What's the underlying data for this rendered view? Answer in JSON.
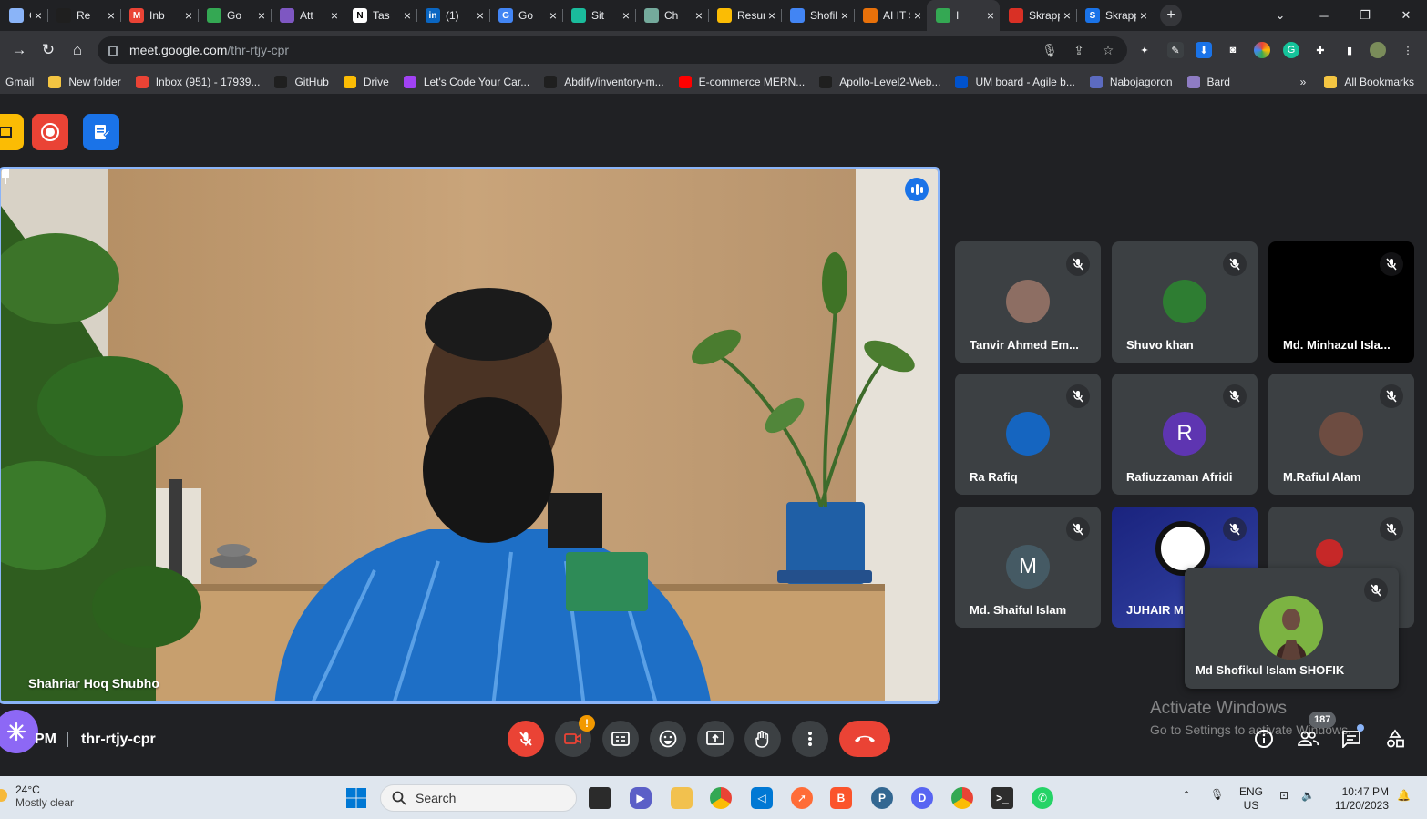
{
  "browser": {
    "tabs": [
      {
        "title": "Cre",
        "color": "#8ab4f8",
        "glyph": ""
      },
      {
        "title": "Re",
        "color": "#1f1f1f",
        "glyph": ""
      },
      {
        "title": "Inb",
        "color": "#ea4335",
        "glyph": "M"
      },
      {
        "title": "Go",
        "color": "#34a853",
        "glyph": ""
      },
      {
        "title": "Att",
        "color": "#7e57c2",
        "glyph": ""
      },
      {
        "title": "Tas",
        "color": "#ffffff",
        "glyph": "N"
      },
      {
        "title": "(1)",
        "color": "#0a66c2",
        "glyph": "in"
      },
      {
        "title": "Go",
        "color": "#4285f4",
        "glyph": "G"
      },
      {
        "title": "Sit",
        "color": "#1abc9c",
        "glyph": ""
      },
      {
        "title": "Ch",
        "color": "#74aa9c",
        "glyph": ""
      },
      {
        "title": "Resume",
        "color": "#fbbc04",
        "glyph": ""
      },
      {
        "title": "Shofiku",
        "color": "#4285f4",
        "glyph": ""
      },
      {
        "title": "AI IT Sh",
        "color": "#e8710a",
        "glyph": ""
      },
      {
        "title": "I",
        "color": "#34a853",
        "glyph": ""
      },
      {
        "title": "Skrappa",
        "color": "#d93025",
        "glyph": ""
      },
      {
        "title": "Skrapp",
        "color": "#1a73e8",
        "glyph": "S"
      }
    ],
    "new_tab_label": "+",
    "url_host": "meet.google.com",
    "url_path": "/thr-rtjy-cpr",
    "bookmarks": [
      {
        "label": "Gmail",
        "color": ""
      },
      {
        "label": "New folder",
        "color": "#f4c542"
      },
      {
        "label": "Inbox (951) - 17939...",
        "color": "#ea4335"
      },
      {
        "label": "GitHub",
        "color": "#1f1f1f"
      },
      {
        "label": "Drive",
        "color": "#fbbc04"
      },
      {
        "label": "Let's Code Your Car...",
        "color": "#a142f4"
      },
      {
        "label": "Abdify/inventory-m...",
        "color": "#1f1f1f"
      },
      {
        "label": "E-commerce MERN...",
        "color": "#ff0000"
      },
      {
        "label": "Apollo-Level2-Web...",
        "color": "#1f1f1f"
      },
      {
        "label": "UM board - Agile b...",
        "color": "#0052cc"
      },
      {
        "label": "Nabojagoron",
        "color": "#5c6bc0"
      },
      {
        "label": "Bard",
        "color": "#8e7cc3"
      }
    ],
    "bookmarks_overflow": "»",
    "all_bookmarks": "All Bookmarks"
  },
  "meet": {
    "main_speaker_name": "Shahriar Hoq Shubho",
    "participants": [
      {
        "name": "Tanvir Ahmed Em...",
        "initial": "",
        "avatar_color": "#8d6e63"
      },
      {
        "name": "Shuvo khan",
        "initial": "",
        "avatar_color": "#2e7d32"
      },
      {
        "name": "Md. Minhazul Isla...",
        "initial": "",
        "avatar_color": "#000000"
      },
      {
        "name": "Ra Rafiq",
        "initial": "",
        "avatar_color": "#1565c0"
      },
      {
        "name": "Rafiuzzaman Afridi",
        "initial": "R",
        "avatar_color": "#5e35b1"
      },
      {
        "name": "M.Rafiul Alam",
        "initial": "",
        "avatar_color": "#6d4c41"
      },
      {
        "name": "Md. Shaiful Islam",
        "initial": "M",
        "avatar_color": "#455a64"
      },
      {
        "name": "JUHAIR M",
        "initial": "",
        "avatar_color": "#1a237e"
      },
      {
        "name": "",
        "initial": "",
        "avatar_color": "#c62828"
      }
    ],
    "self_name": "Md Shofikul Islam SHOFIK",
    "meeting_time_suffix": "PM",
    "meeting_code": "thr-rtjy-cpr",
    "camera_alert": "!",
    "people_count": "187",
    "colors": {
      "accent": "#8ab4f8",
      "end_call": "#ea4335",
      "tile_bg": "#3c4043"
    }
  },
  "watermark": {
    "line1": "Activate Windows",
    "line2": "Go to Settings to activate Windows."
  },
  "taskbar": {
    "temperature": "24°C",
    "condition": "Mostly clear",
    "search_placeholder": "Search",
    "language": "ENG",
    "region": "US",
    "time": "10:47 PM",
    "date": "11/20/2023"
  }
}
